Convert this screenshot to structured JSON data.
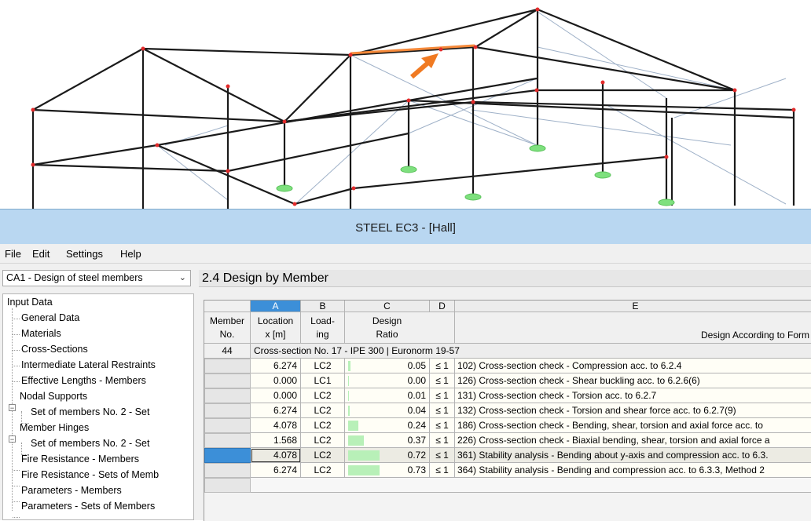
{
  "window": {
    "title": "STEEL EC3 - [Hall]"
  },
  "menu": [
    "File",
    "Edit",
    "Settings",
    "Help"
  ],
  "case_select": {
    "value": "CA1 - Design of steel members"
  },
  "nav_tree": [
    "Input Data",
    "General Data",
    "Materials",
    "Cross-Sections",
    "Intermediate Lateral Restraints",
    "Effective Lengths - Members",
    "Nodal Supports",
    "Set of members No. 2 - Set",
    "Member Hinges",
    "Set of members No. 2 - Set",
    "Fire Resistance - Members",
    "Fire Resistance - Sets of Memb",
    "Parameters - Members",
    "Parameters - Sets of Members"
  ],
  "panel": {
    "title": "2.4 Design by Member"
  },
  "table": {
    "col_letters": [
      "A",
      "B",
      "C",
      "D",
      "E"
    ],
    "headers": {
      "member": [
        "Member",
        "No."
      ],
      "location": [
        "Location",
        "x [m]"
      ],
      "loading": [
        "Load-",
        "ing"
      ],
      "design_ratio": [
        "Design",
        "Ratio"
      ],
      "design_according": "Design According to Form"
    },
    "group": {
      "member_no": "44",
      "label": "Cross-section No.  17 - IPE 300 | Euronorm 19-57"
    },
    "rows": [
      {
        "x": "6.274",
        "lc": "LC2",
        "ratio": "0.05",
        "cmp": "≤ 1",
        "desc": "102) Cross-section check - Compression acc. to 6.2.4"
      },
      {
        "x": "0.000",
        "lc": "LC1",
        "ratio": "0.00",
        "cmp": "≤ 1",
        "desc": "126) Cross-section check - Shear buckling acc. to 6.2.6(6)"
      },
      {
        "x": "0.000",
        "lc": "LC2",
        "ratio": "0.01",
        "cmp": "≤ 1",
        "desc": "131) Cross-section check - Torsion acc. to 6.2.7"
      },
      {
        "x": "6.274",
        "lc": "LC2",
        "ratio": "0.04",
        "cmp": "≤ 1",
        "desc": "132) Cross-section check - Torsion and shear force acc. to 6.2.7(9)"
      },
      {
        "x": "4.078",
        "lc": "LC2",
        "ratio": "0.24",
        "cmp": "≤ 1",
        "desc": "186) Cross-section check - Bending, shear, torsion and axial force acc. to"
      },
      {
        "x": "1.568",
        "lc": "LC2",
        "ratio": "0.37",
        "cmp": "≤ 1",
        "desc": "226) Cross-section check - Biaxial bending, shear, torsion and axial force a"
      },
      {
        "x": "4.078",
        "lc": "LC2",
        "ratio": "0.72",
        "cmp": "≤ 1",
        "desc": "361) Stability analysis - Bending about y-axis and compression acc. to 6.3."
      },
      {
        "x": "6.274",
        "lc": "LC2",
        "ratio": "0.73",
        "cmp": "≤ 1",
        "desc": "364) Stability analysis - Bending and compression acc. to 6.3.3, Method 2"
      }
    ],
    "selected_row": 6
  },
  "colors": {
    "highlight_member": "#f5893a",
    "arrow": "#f07a22",
    "support": "#7ee07e",
    "node": "#e22b2b",
    "ratio_bar": "#b8f0b8",
    "selection": "#3c8fd8"
  }
}
